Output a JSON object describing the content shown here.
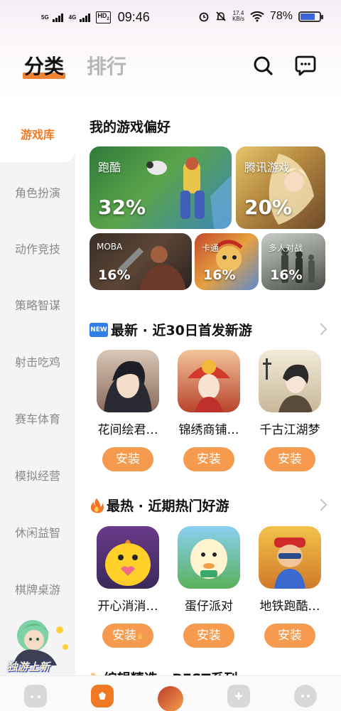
{
  "status_bar": {
    "net1": "5G",
    "net2": "4G",
    "hd": "HD",
    "hd_sub": "2",
    "time": "09:46",
    "speed_value": "17.4",
    "speed_unit": "KB/s",
    "battery": "78%",
    "battery_level": 0.78
  },
  "header": {
    "tab_active": "分类",
    "tab_inactive": "排行",
    "icons": [
      "search-icon",
      "message-icon"
    ]
  },
  "sidebar": {
    "items": [
      {
        "label": "游戏库",
        "active": true
      },
      {
        "label": "角色扮演",
        "active": false
      },
      {
        "label": "动作竞技",
        "active": false
      },
      {
        "label": "策略智谋",
        "active": false
      },
      {
        "label": "射击吃鸡",
        "active": false
      },
      {
        "label": "赛车体育",
        "active": false
      },
      {
        "label": "模拟经营",
        "active": false
      },
      {
        "label": "休闲益智",
        "active": false
      },
      {
        "label": "棋牌桌游",
        "active": false
      }
    ],
    "promo_text": "独游上新"
  },
  "preferences": {
    "title": "我的游戏偏好",
    "tiles": [
      {
        "name": "跑酷",
        "percent": "32%"
      },
      {
        "name": "腾讯游戏",
        "percent": "20%"
      },
      {
        "name": "MOBA",
        "percent": "16%"
      },
      {
        "name": "卡通",
        "percent": "16%"
      },
      {
        "name": "多人对战",
        "percent": "16%"
      }
    ]
  },
  "newest": {
    "badge": "NEW",
    "title": "最新 · 近30日首发新游",
    "games": [
      {
        "name": "花间绘君…",
        "button": "安装"
      },
      {
        "name": "锦绣商铺…",
        "button": "安装"
      },
      {
        "name": "千古江湖梦",
        "button": "安装"
      }
    ]
  },
  "hottest": {
    "title": "最热 · 近期热门好游",
    "games": [
      {
        "name": "开心消消…",
        "button": "安装"
      },
      {
        "name": "蛋仔派对",
        "button": "安装"
      },
      {
        "name": "地铁跑酷…",
        "button": "安装"
      }
    ]
  },
  "editors": {
    "title": "编辑精选 · BEST系列"
  },
  "colors": {
    "accent": "#f08432",
    "install_button": "#f59a4e",
    "sidebar_bg": "#f4f4f4"
  }
}
